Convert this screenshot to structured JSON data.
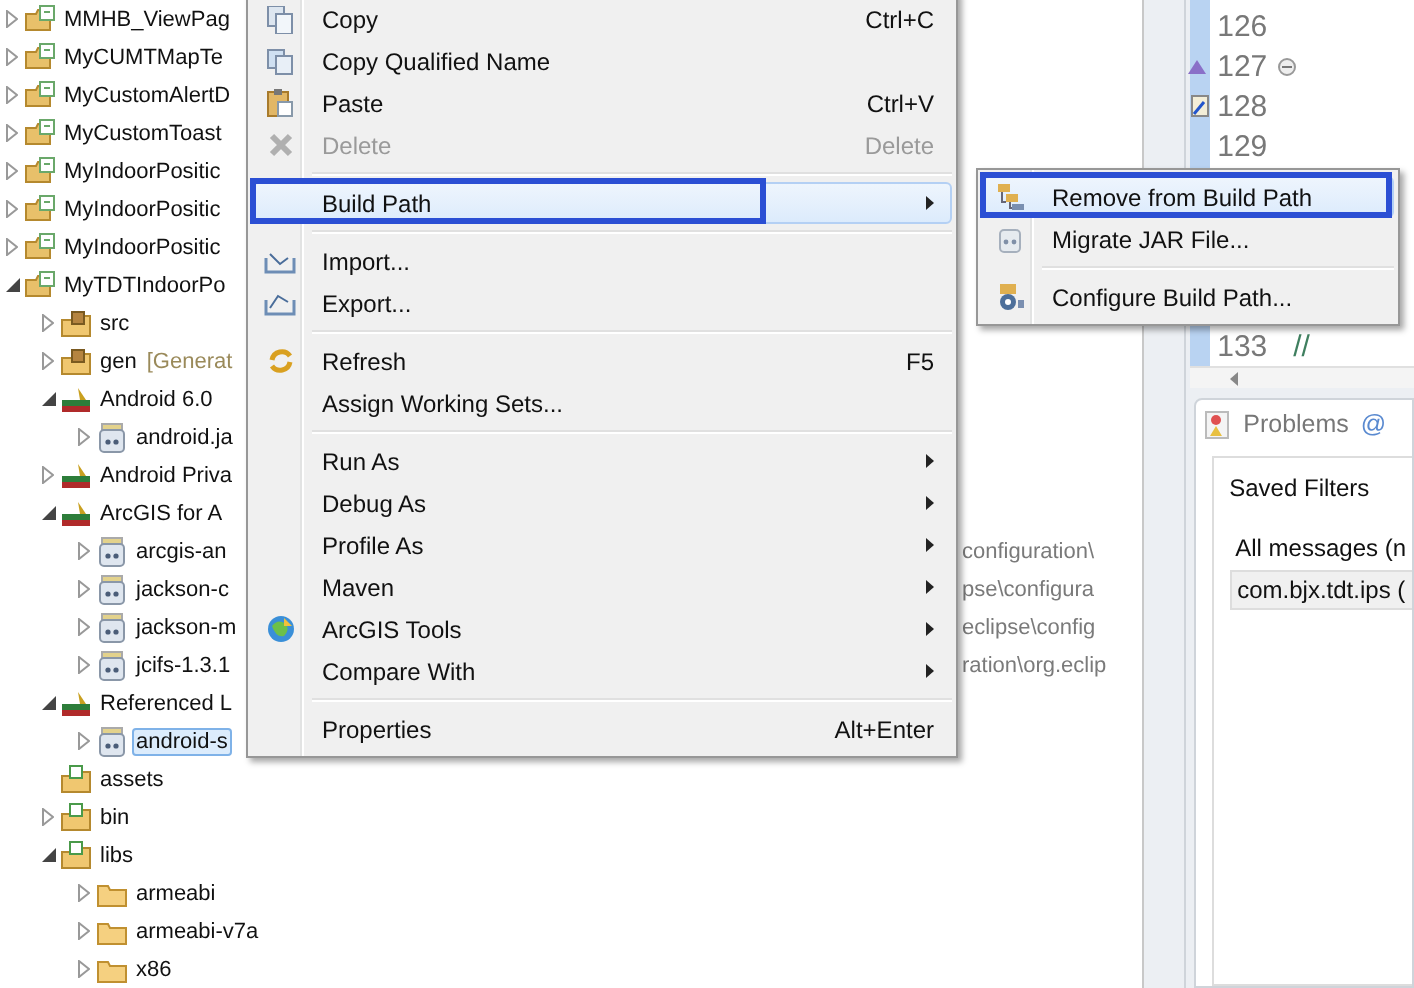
{
  "tree": [
    {
      "label": "MMHB_ViewPag",
      "kind": "project",
      "expanded": false,
      "selected": false
    },
    {
      "label": "MyCUMTMapTe",
      "kind": "project",
      "expanded": false,
      "selected": false
    },
    {
      "label": "MyCustomAlertD",
      "kind": "project",
      "expanded": false,
      "selected": false
    },
    {
      "label": "MyCustomToast",
      "kind": "project",
      "expanded": false,
      "selected": false
    },
    {
      "label": "MyIndoorPositic",
      "kind": "project",
      "expanded": false,
      "selected": false
    },
    {
      "label": "MyIndoorPositic",
      "kind": "project",
      "expanded": false,
      "selected": false
    },
    {
      "label": "MyIndoorPositic",
      "kind": "project",
      "expanded": false,
      "selected": false
    },
    {
      "label": "MyTDTIndoorPo",
      "kind": "project",
      "expanded": true,
      "selected": false,
      "children": [
        {
          "label": "src",
          "kind": "source-folder",
          "expanded": false,
          "selected": false
        },
        {
          "label": "gen",
          "decoration": "[Generat",
          "kind": "source-folder",
          "expanded": false,
          "selected": false
        },
        {
          "label": "Android 6.0",
          "kind": "library",
          "expanded": true,
          "selected": false,
          "children": [
            {
              "label": "android.ja",
              "kind": "jar",
              "expanded": false,
              "selected": false
            }
          ]
        },
        {
          "label": "Android Priva",
          "kind": "library",
          "expanded": false,
          "selected": false
        },
        {
          "label": "ArcGIS for A",
          "kind": "library",
          "expanded": true,
          "selected": false,
          "children": [
            {
              "label": "arcgis-an",
              "tail": "configuration\\",
              "kind": "jar",
              "expanded": false,
              "selected": false
            },
            {
              "label": "jackson-c",
              "tail": "pse\\configura",
              "kind": "jar",
              "expanded": false,
              "selected": false
            },
            {
              "label": "jackson-m",
              "tail": "eclipse\\config",
              "kind": "jar",
              "expanded": false,
              "selected": false
            },
            {
              "label": "jcifs-1.3.1",
              "tail": "ration\\org.eclip",
              "kind": "jar",
              "expanded": false,
              "selected": false
            }
          ]
        },
        {
          "label": "Referenced L",
          "kind": "library",
          "expanded": true,
          "selected": false,
          "children": [
            {
              "label": "android-s",
              "kind": "jar",
              "expanded": false,
              "selected": true
            }
          ]
        },
        {
          "label": "assets",
          "kind": "folder",
          "selected": false
        },
        {
          "label": "bin",
          "kind": "folder",
          "expanded": false,
          "selected": false
        },
        {
          "label": "libs",
          "kind": "folder",
          "expanded": true,
          "selected": false,
          "children": [
            {
              "label": "armeabi",
              "kind": "plain-folder",
              "expanded": false,
              "selected": false
            },
            {
              "label": "armeabi-v7a",
              "kind": "plain-folder",
              "expanded": false,
              "selected": false
            },
            {
              "label": "x86",
              "kind": "plain-folder",
              "expanded": false,
              "selected": false
            }
          ]
        }
      ]
    }
  ],
  "editor": {
    "lines": [
      {
        "number": "126"
      },
      {
        "number": "127"
      },
      {
        "number": "128"
      },
      {
        "number": "129"
      }
    ],
    "bottom_lines": [
      {
        "number": "133",
        "code": "//"
      }
    ]
  },
  "problems": {
    "tabs": [
      {
        "label": "Problems",
        "selected": true
      },
      {
        "label": "@",
        "selected": false
      }
    ],
    "saved_filters": "Saved Filters",
    "filters": [
      "All messages (n",
      "com.bjx.tdt.ips ("
    ]
  },
  "context_menu": {
    "items": [
      {
        "kind": "item",
        "label": "Copy",
        "shortcut": "Ctrl+C",
        "submenu": false,
        "disabled": false,
        "selected": false,
        "annotated": false
      },
      {
        "kind": "item",
        "label": "Copy Qualified Name",
        "submenu": false,
        "disabled": false,
        "selected": false,
        "annotated": false
      },
      {
        "kind": "item",
        "label": "Paste",
        "shortcut": "Ctrl+V",
        "submenu": false,
        "disabled": false,
        "selected": false,
        "annotated": false
      },
      {
        "kind": "item",
        "label": "Delete",
        "shortcut": "Delete",
        "submenu": false,
        "disabled": true,
        "selected": false,
        "annotated": false
      },
      {
        "kind": "separator"
      },
      {
        "kind": "item",
        "label": "Build Path",
        "submenu": true,
        "disabled": false,
        "selected": true,
        "annotated": true
      },
      {
        "kind": "separator"
      },
      {
        "kind": "item",
        "label": "Import...",
        "submenu": false,
        "disabled": false,
        "selected": false,
        "annotated": false
      },
      {
        "kind": "item",
        "label": "Export...",
        "submenu": false,
        "disabled": false,
        "selected": false,
        "annotated": false
      },
      {
        "kind": "separator"
      },
      {
        "kind": "item",
        "label": "Refresh",
        "shortcut": "F5",
        "submenu": false,
        "disabled": false,
        "selected": false,
        "annotated": false
      },
      {
        "kind": "item",
        "label": "Assign Working Sets...",
        "submenu": false,
        "disabled": false,
        "selected": false,
        "annotated": false
      },
      {
        "kind": "separator"
      },
      {
        "kind": "item",
        "label": "Run As",
        "submenu": true,
        "disabled": false,
        "selected": false,
        "annotated": false
      },
      {
        "kind": "item",
        "label": "Debug As",
        "submenu": true,
        "disabled": false,
        "selected": false,
        "annotated": false
      },
      {
        "kind": "item",
        "label": "Profile As",
        "submenu": true,
        "disabled": false,
        "selected": false,
        "annotated": false
      },
      {
        "kind": "item",
        "label": "Maven",
        "submenu": true,
        "disabled": false,
        "selected": false,
        "annotated": false
      },
      {
        "kind": "item",
        "label": "ArcGIS Tools",
        "submenu": true,
        "disabled": false,
        "selected": false,
        "annotated": false
      },
      {
        "kind": "item",
        "label": "Compare With",
        "submenu": true,
        "disabled": false,
        "selected": false,
        "annotated": false
      },
      {
        "kind": "separator"
      },
      {
        "kind": "item",
        "label": "Properties",
        "shortcut": "Alt+Enter",
        "submenu": false,
        "disabled": false,
        "selected": false,
        "annotated": false
      }
    ]
  },
  "submenu": {
    "items": [
      {
        "kind": "item",
        "label": "Remove from Build Path",
        "submenu": false,
        "disabled": false,
        "selected": true,
        "annotated": true
      },
      {
        "kind": "item",
        "label": "Migrate JAR File...",
        "submenu": false,
        "disabled": false,
        "selected": false,
        "annotated": false
      },
      {
        "kind": "separator"
      },
      {
        "kind": "item",
        "label": "Configure Build Path...",
        "submenu": false,
        "disabled": false,
        "selected": false,
        "annotated": false
      }
    ]
  }
}
